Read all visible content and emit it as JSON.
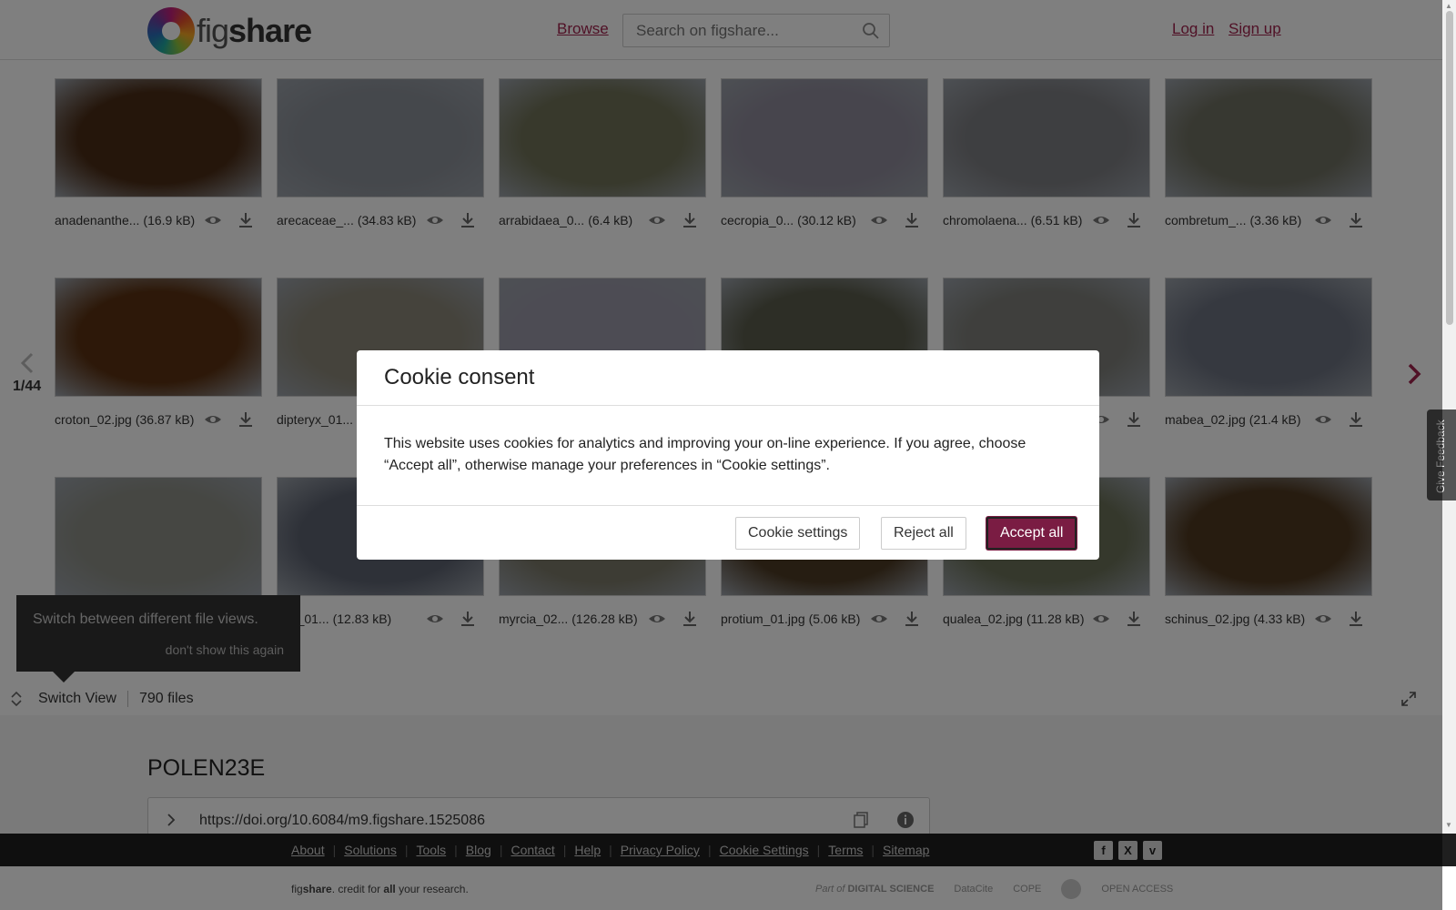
{
  "header": {
    "logo_text_a": "fig",
    "logo_text_b": "share",
    "browse_label": "Browse",
    "search_placeholder": "Search on figshare...",
    "login_label": "Log in",
    "signup_label": "Sign up"
  },
  "gallery": {
    "page_indicator": "1/44",
    "files": [
      {
        "name": "anadenanthe...",
        "size": "(16.9 kB)",
        "color": "#4a2c16"
      },
      {
        "name": "arecaceae_...",
        "size": "(34.83 kB)",
        "color": "#8b9098"
      },
      {
        "name": "arrabidaea_0...",
        "size": "(6.4 kB)",
        "color": "#707258"
      },
      {
        "name": "cecropia_0...",
        "size": "(30.12 kB)",
        "color": "#8e8a9a"
      },
      {
        "name": "chromolaena...",
        "size": "(6.51 kB)",
        "color": "#7d7e82"
      },
      {
        "name": "combretum_...",
        "size": "(3.36 kB)",
        "color": "#6f7062"
      },
      {
        "name": "croton_02.jpg",
        "size": "(36.87 kB)",
        "color": "#5a3112"
      },
      {
        "name": "dipteryx_01...",
        "size": "",
        "color": "#8a8678"
      },
      {
        "name": "",
        "size": "",
        "color": "#9a98a8"
      },
      {
        "name": "",
        "size": "",
        "color": "#5a5c4c"
      },
      {
        "name": "",
        "size": "",
        "color": "#7e7f7a"
      },
      {
        "name": "mabea_02.jpg",
        "size": "(21.4 kB)",
        "color": "#6c7280"
      },
      {
        "name": "",
        "size": "",
        "color": "#8c8e86"
      },
      {
        "name": "osa_01...",
        "size": "(12.83 kB)",
        "color": "#5c6270"
      },
      {
        "name": "myrcia_02...",
        "size": "(126.28 kB)",
        "color": "#7a7868"
      },
      {
        "name": "protium_01.jpg",
        "size": "(5.06 kB)",
        "color": "#4c3a24"
      },
      {
        "name": "qualea_02.jpg",
        "size": "(11.28 kB)",
        "color": "#6a7058"
      },
      {
        "name": "schinus_02.jpg",
        "size": "(4.33 kB)",
        "color": "#4e3820"
      }
    ]
  },
  "tooltip": {
    "text": "Switch between different file views.",
    "dismiss": "don't show this again"
  },
  "viewbar": {
    "switch_label": "Switch View",
    "file_count": "790 files"
  },
  "item": {
    "title": "POLEN23E",
    "doi": "https://doi.org/10.6084/m9.figshare.1525086"
  },
  "feedback_label": "Give Feedback",
  "footer": {
    "links": [
      "About",
      "Solutions",
      "Tools",
      "Blog",
      "Contact",
      "Help",
      "Privacy Policy",
      "Cookie Settings",
      "Terms",
      "Sitemap"
    ],
    "tagline_a": "fig",
    "tagline_b": "share",
    "tagline_c": ". credit for ",
    "tagline_d": "all",
    "tagline_e": " your research.",
    "partner_part_of": "Part of",
    "partner_ds": "DIGITAL SCIENCE",
    "partner_datacite": "DataCite",
    "partner_cope": "COPE",
    "partner_oa": "OPEN ACCESS"
  },
  "cookie": {
    "title": "Cookie consent",
    "body": "This website uses cookies for analytics and improving your on-line experience. If you agree, choose “Accept all”, otherwise manage your preferences in “Cookie settings”.",
    "settings_label": "Cookie settings",
    "reject_label": "Reject all",
    "accept_label": "Accept all"
  },
  "colors": {
    "brand": "#a1224d",
    "accept": "#7a1c43"
  }
}
